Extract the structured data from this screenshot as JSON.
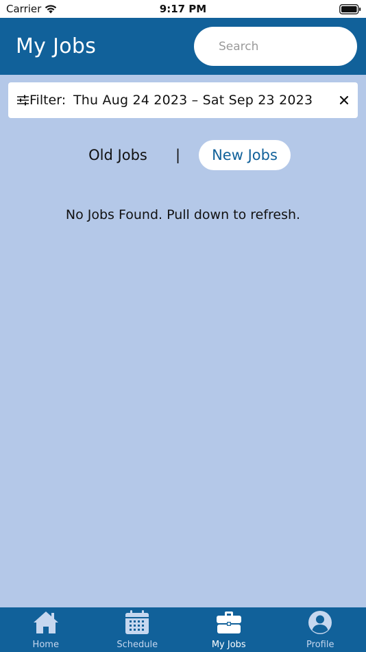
{
  "status_bar": {
    "carrier": "Carrier",
    "time": "9:17 PM"
  },
  "header": {
    "title": "My Jobs"
  },
  "search": {
    "placeholder": "Search"
  },
  "filter": {
    "label": "Filter:",
    "range": "Thu Aug 24 2023  –  Sat Sep 23 2023"
  },
  "tabs": {
    "old": "Old Jobs",
    "divider": "|",
    "new": "New Jobs",
    "selected": "New Jobs"
  },
  "empty_message": "No Jobs Found. Pull down to refresh.",
  "nav": {
    "items": [
      {
        "label": "Home",
        "icon": "home-icon"
      },
      {
        "label": "Schedule",
        "icon": "calendar-icon"
      },
      {
        "label": "My Jobs",
        "icon": "briefcase-icon"
      },
      {
        "label": "Profile",
        "icon": "user-icon"
      }
    ],
    "active": "My Jobs"
  },
  "colors": {
    "header_bg": "#11619a",
    "page_bg": "#b4c8e8",
    "accent": "#11619a",
    "nav_inactive": "#c6d7ef"
  }
}
